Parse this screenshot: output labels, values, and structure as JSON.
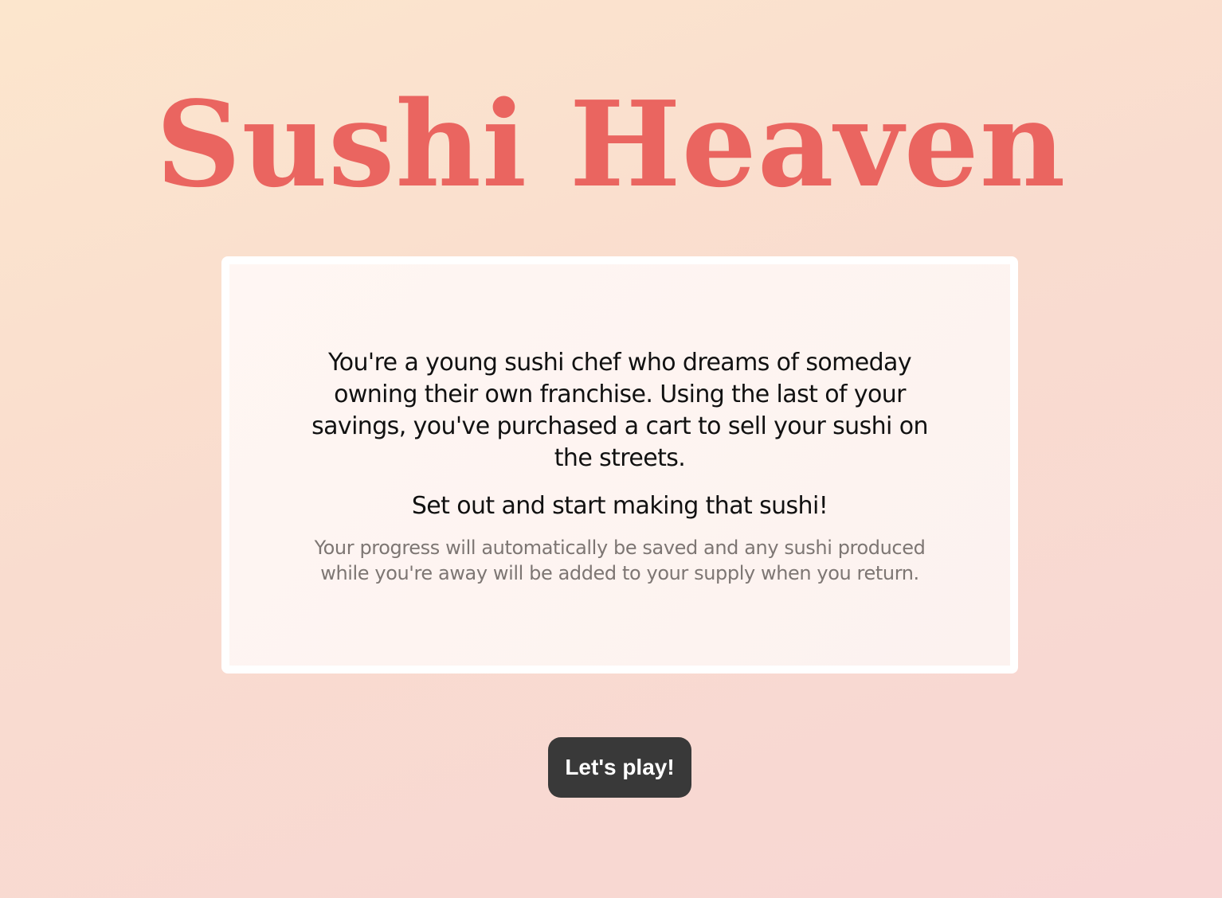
{
  "header": {
    "title": "Sushi Heaven"
  },
  "intro_card": {
    "paragraph": "You're a young sushi chef who dreams of someday owning their own franchise. Using the last of your savings, you've purchased a cart to sell your sushi on the streets.",
    "call_to_action": "Set out and start making that sushi!",
    "note": "Your progress will automatically be saved and any sushi produced while you're away will be added to your supply when you return."
  },
  "actions": {
    "play_label": "Let's play!"
  },
  "colors": {
    "title": "#ea6560",
    "button_bg": "#393939",
    "button_text": "#ffffff",
    "card_border": "#ffffff",
    "note_text": "#7d7673"
  }
}
